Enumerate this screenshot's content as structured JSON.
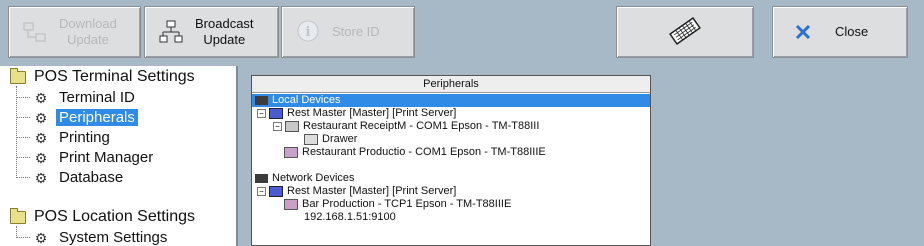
{
  "toolbar": {
    "download_update": [
      "Download",
      "Update"
    ],
    "broadcast_update": [
      "Broadcast",
      "Update"
    ],
    "store_id": "Store ID",
    "close": "Close"
  },
  "nav": {
    "terminal_header": "POS Terminal Settings",
    "terminal_items": [
      "Terminal ID",
      "Peripherals",
      "Printing",
      "Print Manager",
      "Database"
    ],
    "location_header": "POS Location Settings",
    "location_items": [
      "System Settings"
    ]
  },
  "panel": {
    "column_header": "Peripherals",
    "local_devices": "Local Devices",
    "local_server": "Rest Master [Master] [Print Server]",
    "receipt_printer": "Restaurant ReceiptM - COM1 Epson - TM-T88III",
    "drawer": "Drawer",
    "production_printer": "Restaurant Productio - COM1 Epson - TM-T88IIIE",
    "network_devices": "Network Devices",
    "network_server": "Rest Master [Master] [Print Server]",
    "bar_printer": "Bar Production - TCP1 Epson - TM-T88IIIE",
    "ip": "192.168.1.51:9100"
  },
  "colors": {
    "selection": "#2f8be6",
    "background": "#a7b9c7"
  }
}
